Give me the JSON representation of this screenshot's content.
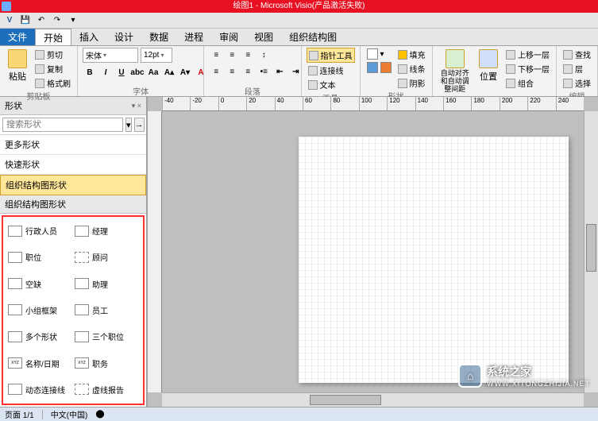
{
  "title": "绘图1 - Microsoft Visio(产品激活失败)",
  "tabs": {
    "file": "文件",
    "items": [
      "开始",
      "插入",
      "设计",
      "数据",
      "进程",
      "审阅",
      "视图",
      "组织结构图"
    ],
    "active": 0
  },
  "ribbon": {
    "clipboard": {
      "paste": "粘贴",
      "cut": "剪切",
      "copy": "复制",
      "painter": "格式刷",
      "label": "剪贴板"
    },
    "font": {
      "name": "宋体",
      "size": "12pt",
      "label": "字体"
    },
    "paragraph": {
      "label": "段落"
    },
    "tools": {
      "pointer": "指针工具",
      "connector": "连接线",
      "text": "文本",
      "label": "工具"
    },
    "shapes": {
      "fill": "填充",
      "line": "线条",
      "shadow": "阴影",
      "label": "形状"
    },
    "arrange": {
      "autoalign": "自动对齐和自动调整间距",
      "position": "位置",
      "front": "上移一层",
      "back": "下移一层",
      "group": "组合",
      "label": "排列"
    },
    "edit": {
      "find": "查找",
      "layer": "层",
      "select": "选择",
      "label": "编辑"
    }
  },
  "shapesPane": {
    "title": "形状",
    "searchPlaceholder": "搜索形状",
    "cats": [
      "更多形状",
      "快速形状",
      "组织结构图形状"
    ],
    "section": "组织结构图形状",
    "shapes": [
      {
        "label": "行政人员"
      },
      {
        "label": "经理"
      },
      {
        "label": "职位"
      },
      {
        "label": "顾问"
      },
      {
        "label": "空缺"
      },
      {
        "label": "助理"
      },
      {
        "label": "小组框架"
      },
      {
        "label": "员工"
      },
      {
        "label": "多个形状"
      },
      {
        "label": "三个职位"
      },
      {
        "label": "名称/日期"
      },
      {
        "label": "职务"
      },
      {
        "label": "动态连接线"
      },
      {
        "label": "虚线报告"
      }
    ]
  },
  "ruler": [
    "-40",
    "-20",
    "0",
    "20",
    "40",
    "60",
    "80",
    "100",
    "120",
    "140",
    "160",
    "180",
    "200",
    "220",
    "240"
  ],
  "status": {
    "page": "页面 1/1",
    "lang": "中文(中国)"
  },
  "watermark": {
    "name": "系统之家",
    "url": "WWW.XITONGZHIJIA.NET"
  }
}
